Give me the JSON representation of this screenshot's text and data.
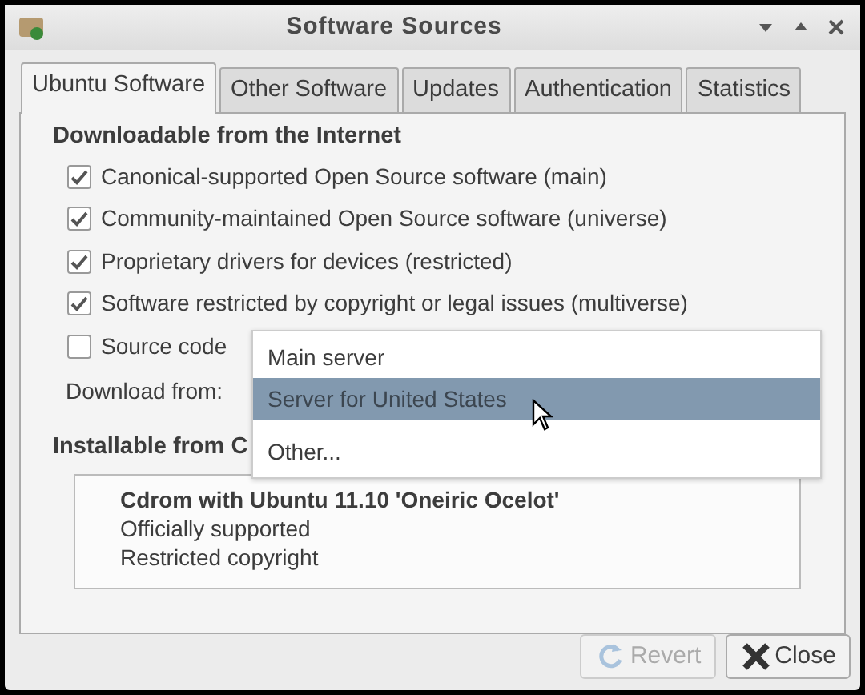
{
  "window": {
    "title": "Software Sources"
  },
  "tabs": [
    {
      "label": "Ubuntu Software",
      "selected": true
    },
    {
      "label": "Other Software",
      "selected": false
    },
    {
      "label": "Updates",
      "selected": false
    },
    {
      "label": "Authentication",
      "selected": false
    },
    {
      "label": "Statistics",
      "selected": false
    }
  ],
  "section_heading": "Downloadable from the Internet",
  "options": [
    {
      "label": "Canonical-supported Open Source software (main)",
      "checked": true
    },
    {
      "label": "Community-maintained Open Source software (universe)",
      "checked": true
    },
    {
      "label": "Proprietary drivers for devices (restricted)",
      "checked": true
    },
    {
      "label": "Software restricted by copyright or legal issues (multiverse)",
      "checked": true
    },
    {
      "label": "Source code",
      "checked": false
    }
  ],
  "download_from": {
    "label": "Download from:",
    "menu": [
      {
        "label": "Main server",
        "selected": false
      },
      {
        "label": "Server for United States",
        "selected": true
      },
      {
        "label": "Other...",
        "selected": false
      }
    ]
  },
  "cdrom_heading": "Installable from C",
  "cdrom_entry": {
    "title": "Cdrom with Ubuntu 11.10 'Oneiric Ocelot'",
    "lines": [
      "Officially supported",
      "Restricted copyright"
    ]
  },
  "buttons": [
    {
      "kind": "revert",
      "label": "Revert",
      "disabled": true
    },
    {
      "kind": "close",
      "label": "Close",
      "disabled": false
    }
  ]
}
